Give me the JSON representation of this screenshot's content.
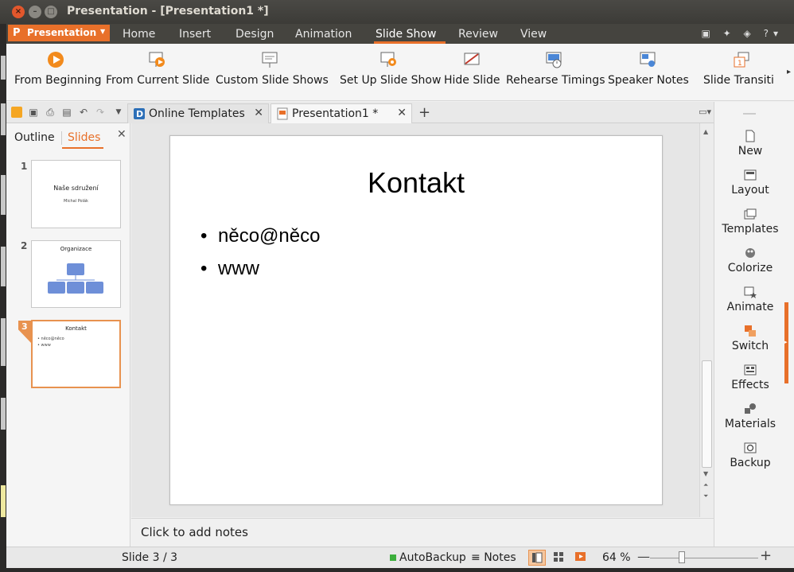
{
  "window": {
    "title": "Presentation - [Presentation1 *]"
  },
  "menubar": {
    "app_menu": "Presentation",
    "tabs": [
      {
        "label": "Home"
      },
      {
        "label": "Insert"
      },
      {
        "label": "Design"
      },
      {
        "label": "Animation"
      },
      {
        "label": "Slide Show"
      },
      {
        "label": "Review"
      },
      {
        "label": "View"
      }
    ],
    "active_tab": "Slide Show"
  },
  "ribbon": {
    "buttons": [
      {
        "label": "From Beginning",
        "icon": "play-icon"
      },
      {
        "label": "From Current Slide",
        "icon": "play-current-icon"
      },
      {
        "label": "Custom Slide Shows",
        "icon": "custom-show-icon"
      },
      {
        "label": "Set Up Slide Show",
        "icon": "setup-show-icon"
      },
      {
        "label": "Hide Slide",
        "icon": "hide-slide-icon"
      },
      {
        "label": "Rehearse Timings",
        "icon": "rehearse-icon"
      },
      {
        "label": "Speaker Notes",
        "icon": "speaker-notes-icon"
      },
      {
        "label": "Slide Transiti",
        "icon": "transition-icon"
      }
    ]
  },
  "doc_tabs": [
    {
      "label": "Online Templates",
      "active": false
    },
    {
      "label": "Presentation1 *",
      "active": true
    }
  ],
  "left_panel": {
    "tab_outline": "Outline",
    "tab_slides": "Slides",
    "thumbs": [
      {
        "num": "1",
        "title": "Naše sdružení",
        "subtitle": "Michal Polák"
      },
      {
        "num": "2",
        "title": "Organizace"
      },
      {
        "num": "3",
        "title": "Kontakt",
        "bullets": [
          "něco@něco",
          "www"
        ]
      }
    ]
  },
  "slide": {
    "title": "Kontakt",
    "bullets": [
      "něco@něco",
      "www"
    ]
  },
  "notes": {
    "placeholder": "Click to add notes"
  },
  "right_pane": {
    "items": [
      {
        "label": "New",
        "icon": "new-slide-icon"
      },
      {
        "label": "Layout",
        "icon": "layout-icon"
      },
      {
        "label": "Templates",
        "icon": "templates-icon"
      },
      {
        "label": "Colorize",
        "icon": "colorize-icon"
      },
      {
        "label": "Animate",
        "icon": "animate-icon"
      },
      {
        "label": "Switch",
        "icon": "switch-icon"
      },
      {
        "label": "Effects",
        "icon": "effects-icon"
      },
      {
        "label": "Materials",
        "icon": "materials-icon"
      },
      {
        "label": "Backup",
        "icon": "backup-icon"
      }
    ]
  },
  "statusbar": {
    "slide_indicator": "Slide 3 / 3",
    "autobackup": "AutoBackup",
    "notes": "Notes",
    "zoom": "64 %",
    "zoom_level_percent": 64
  },
  "colors": {
    "accent": "#e8702a",
    "titlebar": "#3c3b37",
    "menubar": "#45443f"
  }
}
